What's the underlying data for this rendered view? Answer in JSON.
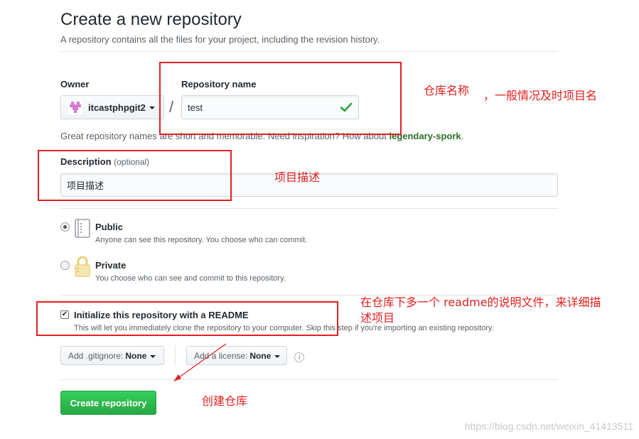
{
  "header": {
    "title": "Create a new repository",
    "subtitle": "A repository contains all the files for your project, including the revision history."
  },
  "owner": {
    "label": "Owner",
    "value": "itcastphpgit2"
  },
  "separator": "/",
  "repo_name": {
    "label": "Repository name",
    "value": "test"
  },
  "hint": {
    "text": "Great repository names are short and memorable. Need inspiration? How about ",
    "suggestion": "legendary-spork",
    "end": "."
  },
  "description": {
    "label": "Description",
    "optional": "(optional)",
    "value": "项目描述"
  },
  "visibility": {
    "public": {
      "title": "Public",
      "note": "Anyone can see this repository. You choose who can commit.",
      "selected": true
    },
    "private": {
      "title": "Private",
      "note": "You choose who can see and commit to this repository.",
      "selected": false
    }
  },
  "readme": {
    "checked": true,
    "label": "Initialize this repository with a README",
    "note": "This will let you immediately clone the repository to your computer. Skip this step if you're importing an existing repository."
  },
  "gitignore": {
    "prefix": "Add .gitignore:",
    "value": "None"
  },
  "license": {
    "prefix": "Add a license:",
    "value": "None"
  },
  "info_icon_glyph": "i",
  "submit_label": "Create repository",
  "annotations": {
    "repo_name_a": "仓库名称",
    "repo_name_b": "，一般情况及时项目名",
    "description": "项目描述",
    "readme_line1": "在仓库下多一个  readme的说明文件，来详细描",
    "readme_line2": "述项目",
    "create": "创建仓库"
  },
  "watermark": "https://blog.csdn.net/weixin_41413511",
  "colors": {
    "annotation_red": "#e02020",
    "create_green": "#28a745",
    "check_green": "#28a745"
  }
}
